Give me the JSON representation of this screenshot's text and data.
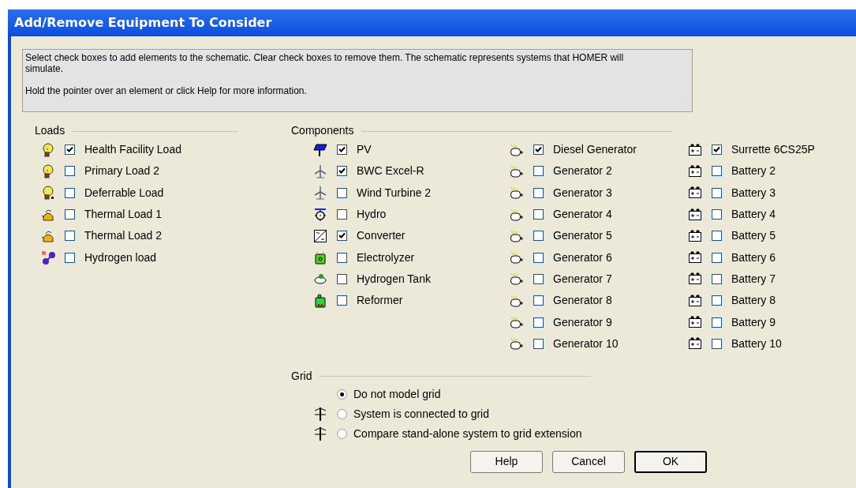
{
  "window": {
    "title": "Add/Remove Equipment To Consider"
  },
  "help_text": [
    "Select check boxes to add elements to the schematic. Clear check boxes to remove them. The schematic represents systems that HOMER will simulate.",
    "Hold the pointer over an element or click Help for more information."
  ],
  "loads": {
    "title": "Loads",
    "items": [
      {
        "kind": "bulb",
        "label": "Health Facility Load",
        "checked": true
      },
      {
        "kind": "bulb",
        "label": "Primary Load 2",
        "checked": false
      },
      {
        "kind": "deferrable",
        "label": "Deferrable Load",
        "checked": false
      },
      {
        "kind": "kettle",
        "label": "Thermal Load 1",
        "checked": false
      },
      {
        "kind": "kettle",
        "label": "Thermal Load 2",
        "checked": false
      },
      {
        "kind": "hydrogen",
        "label": "Hydrogen load",
        "checked": false
      }
    ]
  },
  "components": {
    "title": "Components",
    "columns": [
      [
        {
          "kind": "pv",
          "label": "PV",
          "checked": true
        },
        {
          "kind": "wind",
          "label": "BWC Excel-R",
          "checked": true
        },
        {
          "kind": "wind",
          "label": "Wind Turbine 2",
          "checked": false
        },
        {
          "kind": "hydro",
          "label": "Hydro",
          "checked": false
        },
        {
          "kind": "converter",
          "label": "Converter",
          "checked": true
        },
        {
          "kind": "electrolyzer",
          "label": "Electrolyzer",
          "checked": false
        },
        {
          "kind": "tank",
          "label": "Hydrogen Tank",
          "checked": false
        },
        {
          "kind": "reformer",
          "label": "Reformer",
          "checked": false
        }
      ],
      [
        {
          "kind": "generator",
          "label": "Diesel Generator",
          "checked": true
        },
        {
          "kind": "generator",
          "label": "Generator 2",
          "checked": false
        },
        {
          "kind": "generator",
          "label": "Generator 3",
          "checked": false
        },
        {
          "kind": "generator",
          "label": "Generator 4",
          "checked": false
        },
        {
          "kind": "generator",
          "label": "Generator 5",
          "checked": false
        },
        {
          "kind": "generator",
          "label": "Generator 6",
          "checked": false
        },
        {
          "kind": "generator",
          "label": "Generator 7",
          "checked": false
        },
        {
          "kind": "generator",
          "label": "Generator 8",
          "checked": false
        },
        {
          "kind": "generator",
          "label": "Generator 9",
          "checked": false
        },
        {
          "kind": "generator",
          "label": "Generator 10",
          "checked": false
        }
      ],
      [
        {
          "kind": "battery",
          "label": "Surrette 6CS25P",
          "checked": true
        },
        {
          "kind": "battery",
          "label": "Battery 2",
          "checked": false
        },
        {
          "kind": "battery",
          "label": "Battery 3",
          "checked": false
        },
        {
          "kind": "battery",
          "label": "Battery 4",
          "checked": false
        },
        {
          "kind": "battery",
          "label": "Battery 5",
          "checked": false
        },
        {
          "kind": "battery",
          "label": "Battery 6",
          "checked": false
        },
        {
          "kind": "battery",
          "label": "Battery 7",
          "checked": false
        },
        {
          "kind": "battery",
          "label": "Battery 8",
          "checked": false
        },
        {
          "kind": "battery",
          "label": "Battery 9",
          "checked": false
        },
        {
          "kind": "battery",
          "label": "Battery 10",
          "checked": false
        }
      ]
    ]
  },
  "grid": {
    "title": "Grid",
    "options": [
      {
        "kind": "plain",
        "label": "Do not model grid",
        "selected": true
      },
      {
        "kind": "tower",
        "label": "System is connected to grid",
        "selected": false
      },
      {
        "kind": "tower",
        "label": "Compare stand-alone system to grid extension",
        "selected": false
      }
    ]
  },
  "buttons": [
    {
      "label": "Help",
      "default": false
    },
    {
      "label": "Cancel",
      "default": false
    },
    {
      "label": "OK",
      "default": true
    }
  ]
}
